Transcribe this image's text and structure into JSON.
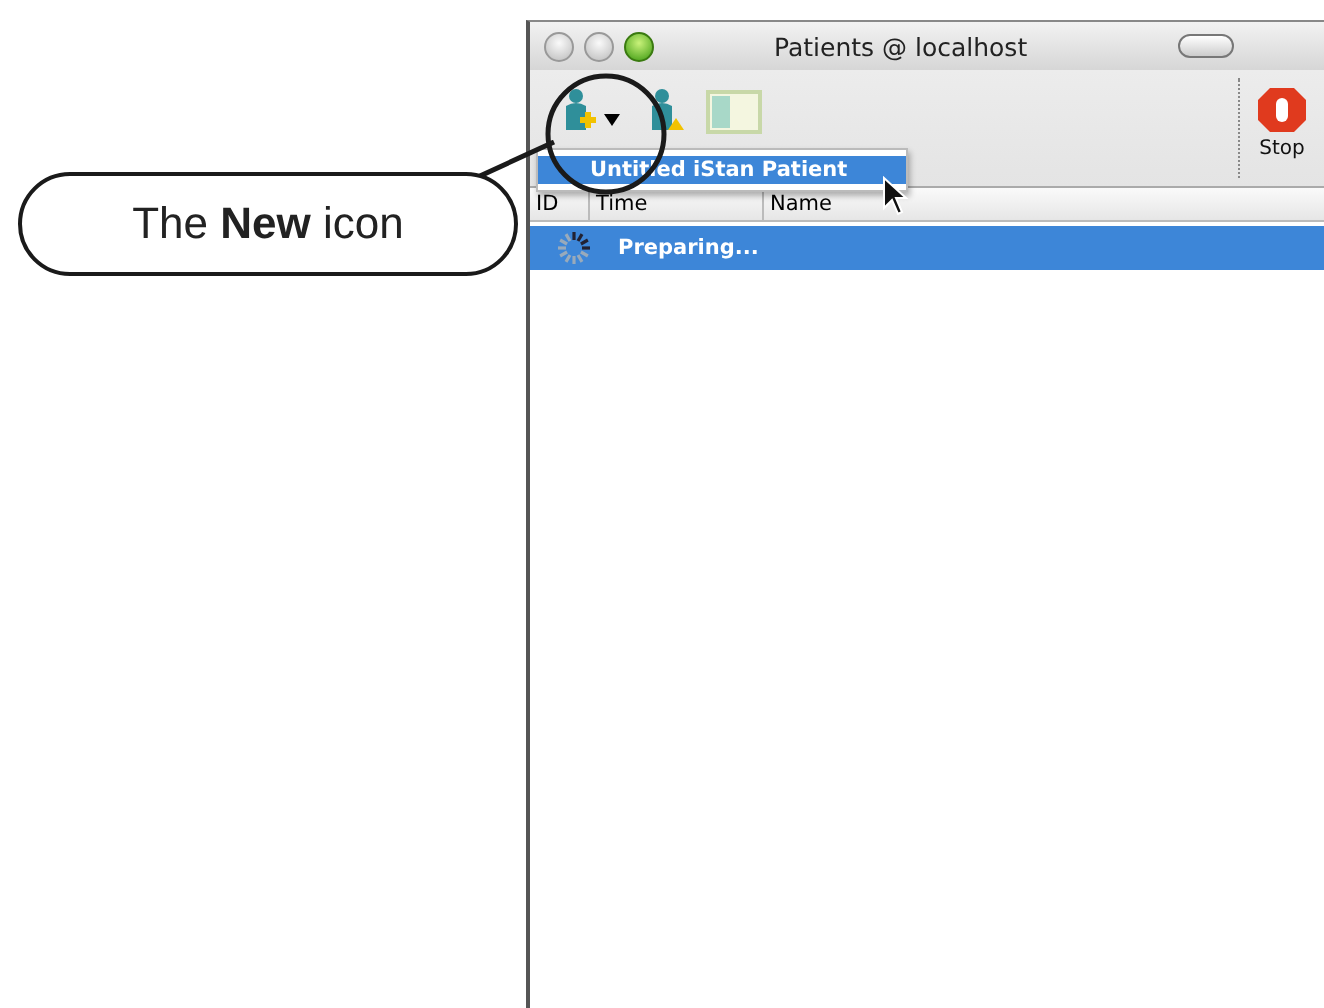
{
  "callout": {
    "text": "The **New** icon"
  },
  "window": {
    "title": "Patients @ localhost"
  },
  "toolbar": {
    "items": [
      {
        "kind": "new"
      },
      {
        "kind": "open"
      },
      {
        "kind": "view"
      }
    ],
    "stop_label": "Stop"
  },
  "menu": {
    "items": [
      {
        "label": "Untitled iStan Patient",
        "selected": true
      }
    ]
  },
  "table": {
    "columns": [
      "ID",
      "Time",
      "Name"
    ],
    "rows": [
      {
        "cells": [
          "Preparing..."
        ],
        "selected": true,
        "loading": true
      }
    ]
  }
}
